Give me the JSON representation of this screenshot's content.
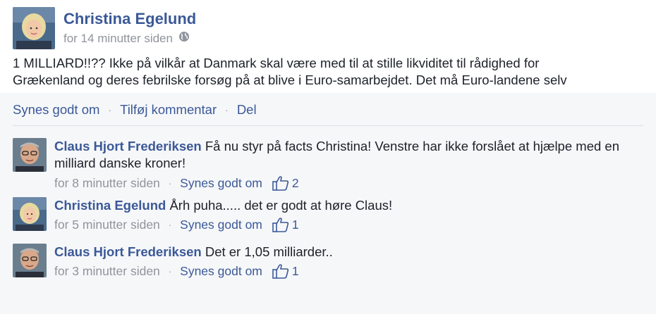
{
  "post": {
    "author": "Christina Egelund",
    "time": "for 14 minutter siden",
    "privacy_icon": "globe-icon",
    "text_lines": [
      "1 MILLIARD!!?? Ikke på vilkår at Danmark skal være med til at stille likviditet til rådighed for",
      "Grækenland og deres febrilske forsøg på at blive i Euro-samarbejdet. Det må Euro-landene selv"
    ]
  },
  "actions": {
    "like": "Synes godt om",
    "comment": "Tilføj kommentar",
    "share": "Del"
  },
  "comments": [
    {
      "author": "Claus Hjort Frederiksen",
      "text": "Få nu styr på facts Christina! Venstre har ikke forslået at hjælpe med en milliard danske kroner!",
      "time": "for 8 minutter siden",
      "like_label": "Synes godt om",
      "likes": "2"
    },
    {
      "author": "Christina Egelund",
      "text": "Årh puha..... det er godt at høre Claus!",
      "time": "for 5 minutter siden",
      "like_label": "Synes godt om",
      "likes": "1"
    },
    {
      "author": "Claus Hjort Frederiksen",
      "text": "Det er 1,05 milliarder..",
      "time": "for 3 minutter siden",
      "like_label": "Synes godt om",
      "likes": "1"
    }
  ],
  "colors": {
    "link": "#3b5998",
    "meta": "#90949c",
    "background": "#f6f7f9"
  }
}
